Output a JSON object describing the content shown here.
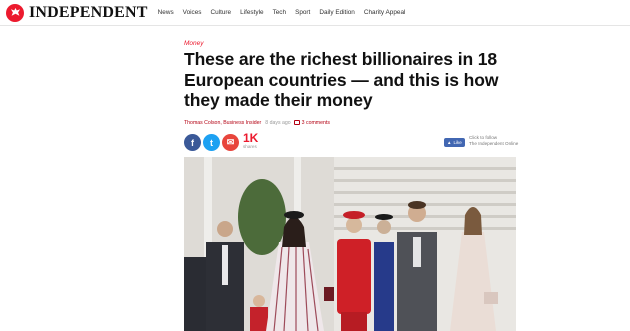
{
  "brand": {
    "name": "INDEPENDENT",
    "logo_icon": "eagle-icon",
    "color": "#ec1a2e"
  },
  "nav": [
    "News",
    "Voices",
    "Culture",
    "Lifestyle",
    "Tech",
    "Sport",
    "Daily Edition",
    "Charity Appeal"
  ],
  "article": {
    "section": "Money",
    "headline": "These are the richest billionaires in 18 European countries — and this is how they made their money",
    "author": "Thomas Colson, Business Insider",
    "time": "8 days ago",
    "comments": "3 comments"
  },
  "share": {
    "facebook_icon": "f",
    "twitter_icon": "t",
    "email_icon": "✉",
    "count": "1K",
    "count_label": "shares",
    "like_label": "Like",
    "follow_line1": "Click to follow",
    "follow_line2": "The Independent Online"
  }
}
